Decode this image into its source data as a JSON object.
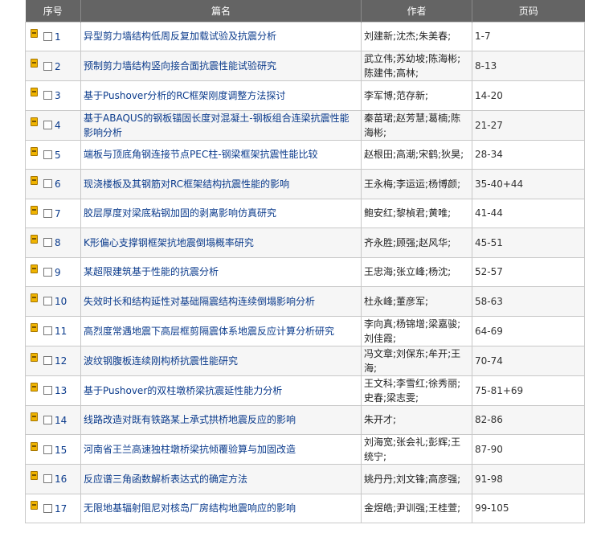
{
  "header": {
    "seq": "序号",
    "title": "篇名",
    "authors": "作者",
    "pages": "页码"
  },
  "rows": [
    {
      "num": "1",
      "title": "异型剪力墙结构低周反复加载试验及抗震分析",
      "authors": "刘建新;沈杰;朱美春;",
      "pages": "1-7"
    },
    {
      "num": "2",
      "title": "预制剪力墙结构竖向接合面抗震性能试验研究",
      "authors": "武立伟;苏幼坡;陈海彬;陈建伟;高林;",
      "pages": "8-13"
    },
    {
      "num": "3",
      "title": "基于Pushover分析的RC框架刚度调整方法探讨",
      "authors": "李军博;范存新;",
      "pages": "14-20"
    },
    {
      "num": "4",
      "title": "基于ABAQUS的钢板锚固长度对混凝土-钢板组合连梁抗震性能影响分析",
      "authors": "秦苗珺;赵芳慧;葛楠;陈海彬;",
      "pages": "21-27"
    },
    {
      "num": "5",
      "title": "端板与顶底角钢连接节点PEC柱-钢梁框架抗震性能比较",
      "authors": "赵根田;高潮;宋鹤;狄昊;",
      "pages": "28-34"
    },
    {
      "num": "6",
      "title": "现浇楼板及其钢筋对RC框架结构抗震性能的影响",
      "authors": "王永梅;李运运;杨博颜;",
      "pages": "35-40+44"
    },
    {
      "num": "7",
      "title": "胶层厚度对梁底粘钢加固的剥离影响仿真研究",
      "authors": "鲍安红;黎楨君;黄唯;",
      "pages": "41-44"
    },
    {
      "num": "8",
      "title": "K形偏心支撑钢框架抗地震倒塌概率研究",
      "authors": "齐永胜;顾强;赵风华;",
      "pages": "45-51"
    },
    {
      "num": "9",
      "title": "某超限建筑基于性能的抗震分析",
      "authors": "王忠海;张立峰;杨沈;",
      "pages": "52-57"
    },
    {
      "num": "10",
      "title": "失效时长和结构延性对基础隔震结构连续倒塌影响分析",
      "authors": "杜永峰;董彦军;",
      "pages": "58-63"
    },
    {
      "num": "11",
      "title": "高烈度常遇地震下高层框剪隔震体系地震反应计算分析研究",
      "authors": "李向真;杨锦增;梁嘉骏;刘佳霞;",
      "pages": "64-69"
    },
    {
      "num": "12",
      "title": "波纹钢腹板连续刚构桥抗震性能研究",
      "authors": "冯文章;刘保东;牟开;王海;",
      "pages": "70-74"
    },
    {
      "num": "13",
      "title": "基于Pushover的双柱墩桥梁抗震延性能力分析",
      "authors": "王文科;李雪红;徐秀丽;史春;梁志雯;",
      "pages": "75-81+69"
    },
    {
      "num": "14",
      "title": "线路改造对既有铁路某上承式拱桥地震反应的影响",
      "authors": "朱开才;",
      "pages": "82-86"
    },
    {
      "num": "15",
      "title": "河南省王兰高速独柱墩桥梁抗倾覆验算与加固改造",
      "authors": "刘海宽;张会礼;彭辉;王统宁;",
      "pages": "87-90"
    },
    {
      "num": "16",
      "title": "反应谱三角函数解析表达式的确定方法",
      "authors": "姚丹丹;刘文锋;高彦强;",
      "pages": "91-98"
    },
    {
      "num": "17",
      "title": "无限地基辐射阻尼对核岛厂房结构地震响应的影响",
      "authors": "金煜皓;尹训强;王桂萱;",
      "pages": "99-105"
    }
  ]
}
